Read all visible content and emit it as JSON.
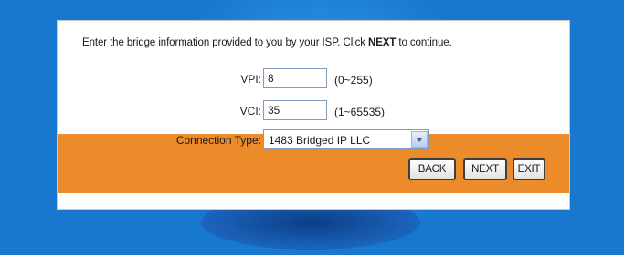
{
  "instructions": {
    "before": "Enter the bridge information provided to you by your ISP. Click ",
    "emphasis": "NEXT",
    "after": " to continue."
  },
  "vpi": {
    "label": "VPI:",
    "value": "8",
    "range": "(0~255)"
  },
  "vci": {
    "label": "VCI:",
    "value": "35",
    "range": "(1~65535)"
  },
  "connection_type": {
    "label": "Connection Type:",
    "selected": "1483 Bridged IP LLC"
  },
  "buttons": {
    "back": "BACK",
    "next": "NEXT",
    "exit": "EXIT"
  },
  "colors": {
    "background": "#1877cf",
    "action_bar": "#ec8b2a"
  }
}
